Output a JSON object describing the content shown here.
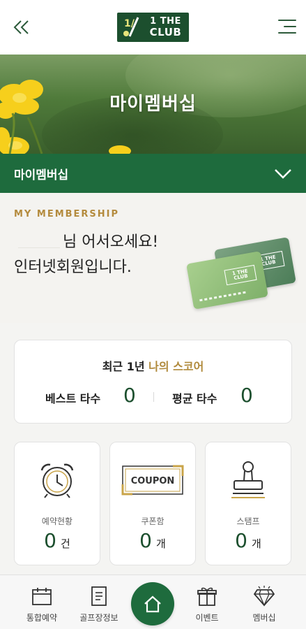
{
  "header": {
    "logo_line1": "1 THE",
    "logo_line2": "CLUB",
    "logo_mark": "1/",
    "back_icon": "double-chevron-left-icon",
    "menu_icon": "hamburger-menu-icon"
  },
  "hero": {
    "title": "마이멤버십"
  },
  "section_select": {
    "label": "마이멤버십",
    "icon": "chevron-down-icon"
  },
  "membership": {
    "eyebrow": "MY MEMBERSHIP",
    "greeting": "님 어서오세요!",
    "member_type": "인터넷회원입니다.",
    "card_logo_line1": "1 THE",
    "card_logo_line2": "CLUB"
  },
  "score": {
    "title_prefix": "최근 1년",
    "title_highlight": "나의 스코어",
    "best_label": "베스트 타수",
    "best_value": "0",
    "avg_label": "평균 타수",
    "avg_value": "0"
  },
  "tiles": [
    {
      "label": "예약현황",
      "count": "0",
      "unit": "건",
      "icon": "alarm-clock-icon"
    },
    {
      "label": "쿠폰함",
      "count": "0",
      "unit": "개",
      "icon": "coupon-icon",
      "icon_text": "COUPON"
    },
    {
      "label": "스탬프",
      "count": "0",
      "unit": "개",
      "icon": "stamp-icon"
    }
  ],
  "bottom_nav": [
    {
      "label": "통합예약",
      "icon": "calendar-icon"
    },
    {
      "label": "골프장정보",
      "icon": "document-icon"
    },
    {
      "label": "",
      "icon": "home-icon"
    },
    {
      "label": "이벤트",
      "icon": "gift-icon"
    },
    {
      "label": "멤버십",
      "icon": "diamond-icon"
    }
  ],
  "colors": {
    "brand_green": "#1e6b3d",
    "dark_green": "#1c4f2e",
    "gold": "#b08a3c"
  }
}
